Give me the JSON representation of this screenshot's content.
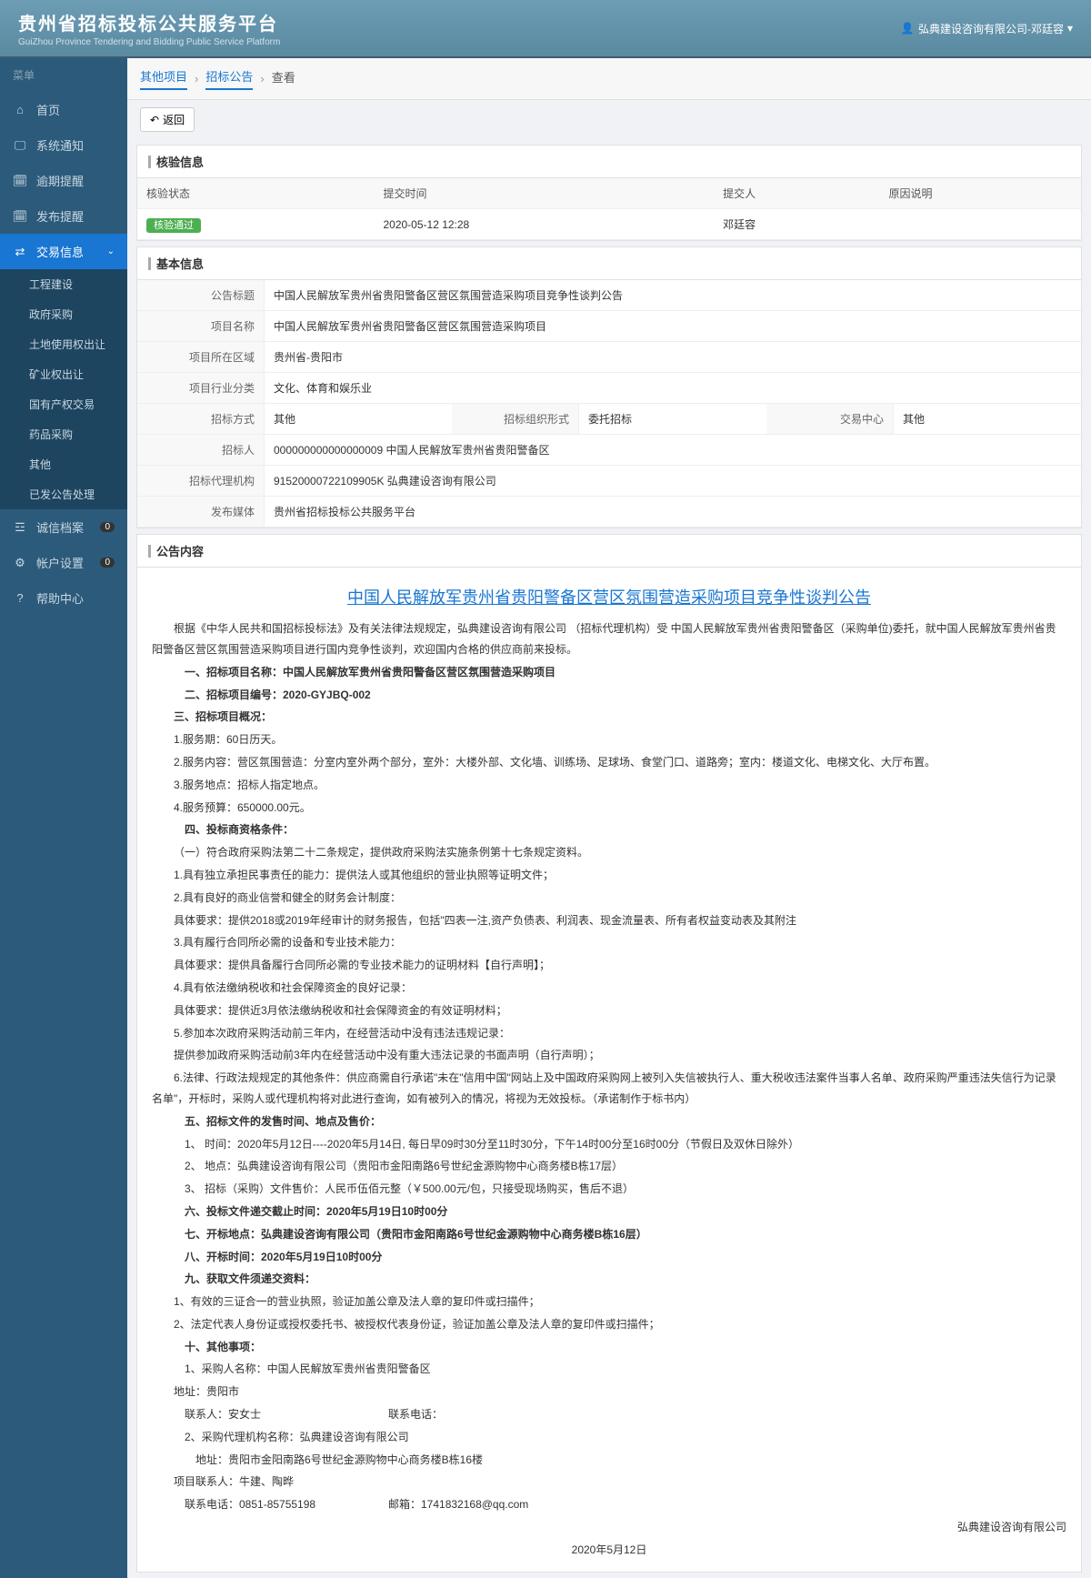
{
  "header": {
    "title": "贵州省招标投标公共服务平台",
    "subtitle": "GuiZhou Province Tendering and Bidding Public Service Platform",
    "user": "弘典建设咨询有限公司-邓廷容"
  },
  "sidebar": {
    "menu_label": "菜单",
    "items": [
      {
        "label": "首页"
      },
      {
        "label": "系统通知"
      },
      {
        "label": "逾期提醒"
      },
      {
        "label": "发布提醒"
      },
      {
        "label": "交易信息",
        "active": true
      },
      {
        "label": "诚信档案",
        "badge": "0"
      },
      {
        "label": "帐户设置",
        "badge": "0"
      },
      {
        "label": "帮助中心"
      }
    ],
    "sub_items": [
      {
        "label": "工程建设"
      },
      {
        "label": "政府采购"
      },
      {
        "label": "土地使用权出让"
      },
      {
        "label": "矿业权出让"
      },
      {
        "label": "国有产权交易"
      },
      {
        "label": "药品采购"
      },
      {
        "label": "其他"
      },
      {
        "label": "已发公告处理"
      }
    ]
  },
  "breadcrumb": [
    "其他项目",
    "招标公告",
    "查看"
  ],
  "back_button": "返回",
  "verify": {
    "title": "核验信息",
    "headers": [
      "核验状态",
      "提交时间",
      "提交人",
      "原因说明"
    ],
    "row": {
      "status": "核验通过",
      "time": "2020-05-12 12:28",
      "submitter": "邓廷容",
      "reason": ""
    }
  },
  "basic": {
    "title": "基本信息",
    "rows": {
      "announce_title_label": "公告标题",
      "announce_title": "中国人民解放军贵州省贵阳警备区营区氛围营造采购项目竞争性谈判公告",
      "project_name_label": "项目名称",
      "project_name": "中国人民解放军贵州省贵阳警备区营区氛围营造采购项目",
      "region_label": "项目所在区域",
      "region": "贵州省-贵阳市",
      "industry_label": "项目行业分类",
      "industry": "文化、体育和娱乐业",
      "tender_method_label": "招标方式",
      "tender_method": "其他",
      "org_form_label": "招标组织形式",
      "org_form": "委托招标",
      "trade_center_label": "交易中心",
      "trade_center": "其他",
      "tenderer_label": "招标人",
      "tenderer": "000000000000000009 中国人民解放军贵州省贵阳警备区",
      "agency_label": "招标代理机构",
      "agency": "91520000722109905K 弘典建设咨询有限公司",
      "media_label": "发布媒体",
      "media": "贵州省招标投标公共服务平台"
    }
  },
  "content": {
    "section_title": "公告内容",
    "title": "中国人民解放军贵州省贵阳警备区营区氛围营造采购项目竞争性谈判公告",
    "intro": "根据《中华人民共和国招标投标法》及有关法律法规规定，弘典建设咨询有限公司 （招标代理机构）受  中国人民解放军贵州省贵阳警备区（采购单位)委托，就中国人民解放军贵州省贵阳警备区营区氛围营造采购项目进行国内竞争性谈判，欢迎国内合格的供应商前来投标。",
    "p1": "一、招标项目名称：中国人民解放军贵州省贵阳警备区营区氛围营造采购项目",
    "p2": "二、招标项目编号：2020-GYJBQ-002",
    "p3": "三、招标项目概况：",
    "p3_1": "1.服务期：60日历天。",
    "p3_2": "2.服务内容：营区氛围营造：分室内室外两个部分，室外：大楼外部、文化墙、训练场、足球场、食堂门口、道路旁；室内：楼道文化、电梯文化、大厅布置。",
    "p3_3": "3.服务地点：招标人指定地点。",
    "p3_4": "4.服务预算：650000.00元。",
    "p4": "四、投标商资格条件：",
    "p4_0": "（一）符合政府采购法第二十二条规定，提供政府采购法实施条例第十七条规定资料。",
    "p4_1": "1.具有独立承担民事责任的能力：提供法人或其他组织的营业执照等证明文件；",
    "p4_2": "2.具有良好的商业信誉和健全的财务会计制度：",
    "p4_2a": "具体要求：提供2018或2019年经审计的财务报告，包括\"四表一注,资产负债表、利润表、现金流量表、所有者权益变动表及其附注",
    "p4_3": "3.具有履行合同所必需的设备和专业技术能力：",
    "p4_3a": "具体要求：提供具备履行合同所必需的专业技术能力的证明材料【自行声明】；",
    "p4_4": "4.具有依法缴纳税收和社会保障资金的良好记录：",
    "p4_4a": "具体要求：提供近3月依法缴纳税收和社会保障资金的有效证明材料；",
    "p4_5": "5.参加本次政府采购活动前三年内，在经营活动中没有违法违规记录：",
    "p4_5a": "提供参加政府采购活动前3年内在经营活动中没有重大违法记录的书面声明（自行声明）；",
    "p4_6": "6.法律、行政法规规定的其他条件：供应商需自行承诺\"未在\"信用中国\"网站上及中国政府采购网上被列入失信被执行人、重大税收违法案件当事人名单、政府采购严重违法失信行为记录名单\"，开标时，采购人或代理机构将对此进行查询，如有被列入的情况，将视为无效投标。（承诺制作于标书内）",
    "p5": "五、招标文件的发售时间、地点及售价：",
    "p5_1": "1、 时间：2020年5月12日----2020年5月14日, 每日早09时30分至11时30分，下午14时00分至16时00分（节假日及双休日除外）",
    "p5_2": "2、 地点：弘典建设咨询有限公司（贵阳市金阳南路6号世纪金源购物中心商务楼B栋17层）",
    "p5_3": "3、 招标（采购）文件售价：人民币伍佰元整（￥500.00元/包，只接受现场购买，售后不退）",
    "p6": "六、投标文件递交截止时间：2020年5月19日10时00分",
    "p7": "七、开标地点：弘典建设咨询有限公司（贵阳市金阳南路6号世纪金源购物中心商务楼B栋16层）",
    "p8": "八、开标时间：2020年5月19日10时00分",
    "p9": "九、获取文件须递交资料：",
    "p9_1": "1、有效的三证合一的营业执照，验证加盖公章及法人章的复印件或扫描件；",
    "p9_2": "2、法定代表人身份证或授权委托书、被授权代表身份证，验证加盖公章及法人章的复印件或扫描件；",
    "p10": "十、其他事项：",
    "p10_1": "1、采购人名称：中国人民解放军贵州省贵阳警备区",
    "p10_addr": "地址：贵阳市",
    "p10_contact": "联系人：安女士",
    "p10_phone_label": "联系电话：",
    "p10_2": "2、采购代理机构名称：弘典建设咨询有限公司",
    "p10_2addr": "地址：贵阳市金阳南路6号世纪金源购物中心商务楼B栋16楼",
    "p10_pm": "项目联系人：牛建、陶晔",
    "p10_pm_phone": "联系电话：0851-85755198",
    "p10_email_label": "邮箱：1741832168@qq.com",
    "sign_company": "弘典建设咨询有限公司",
    "sign_date": "2020年5月12日"
  }
}
